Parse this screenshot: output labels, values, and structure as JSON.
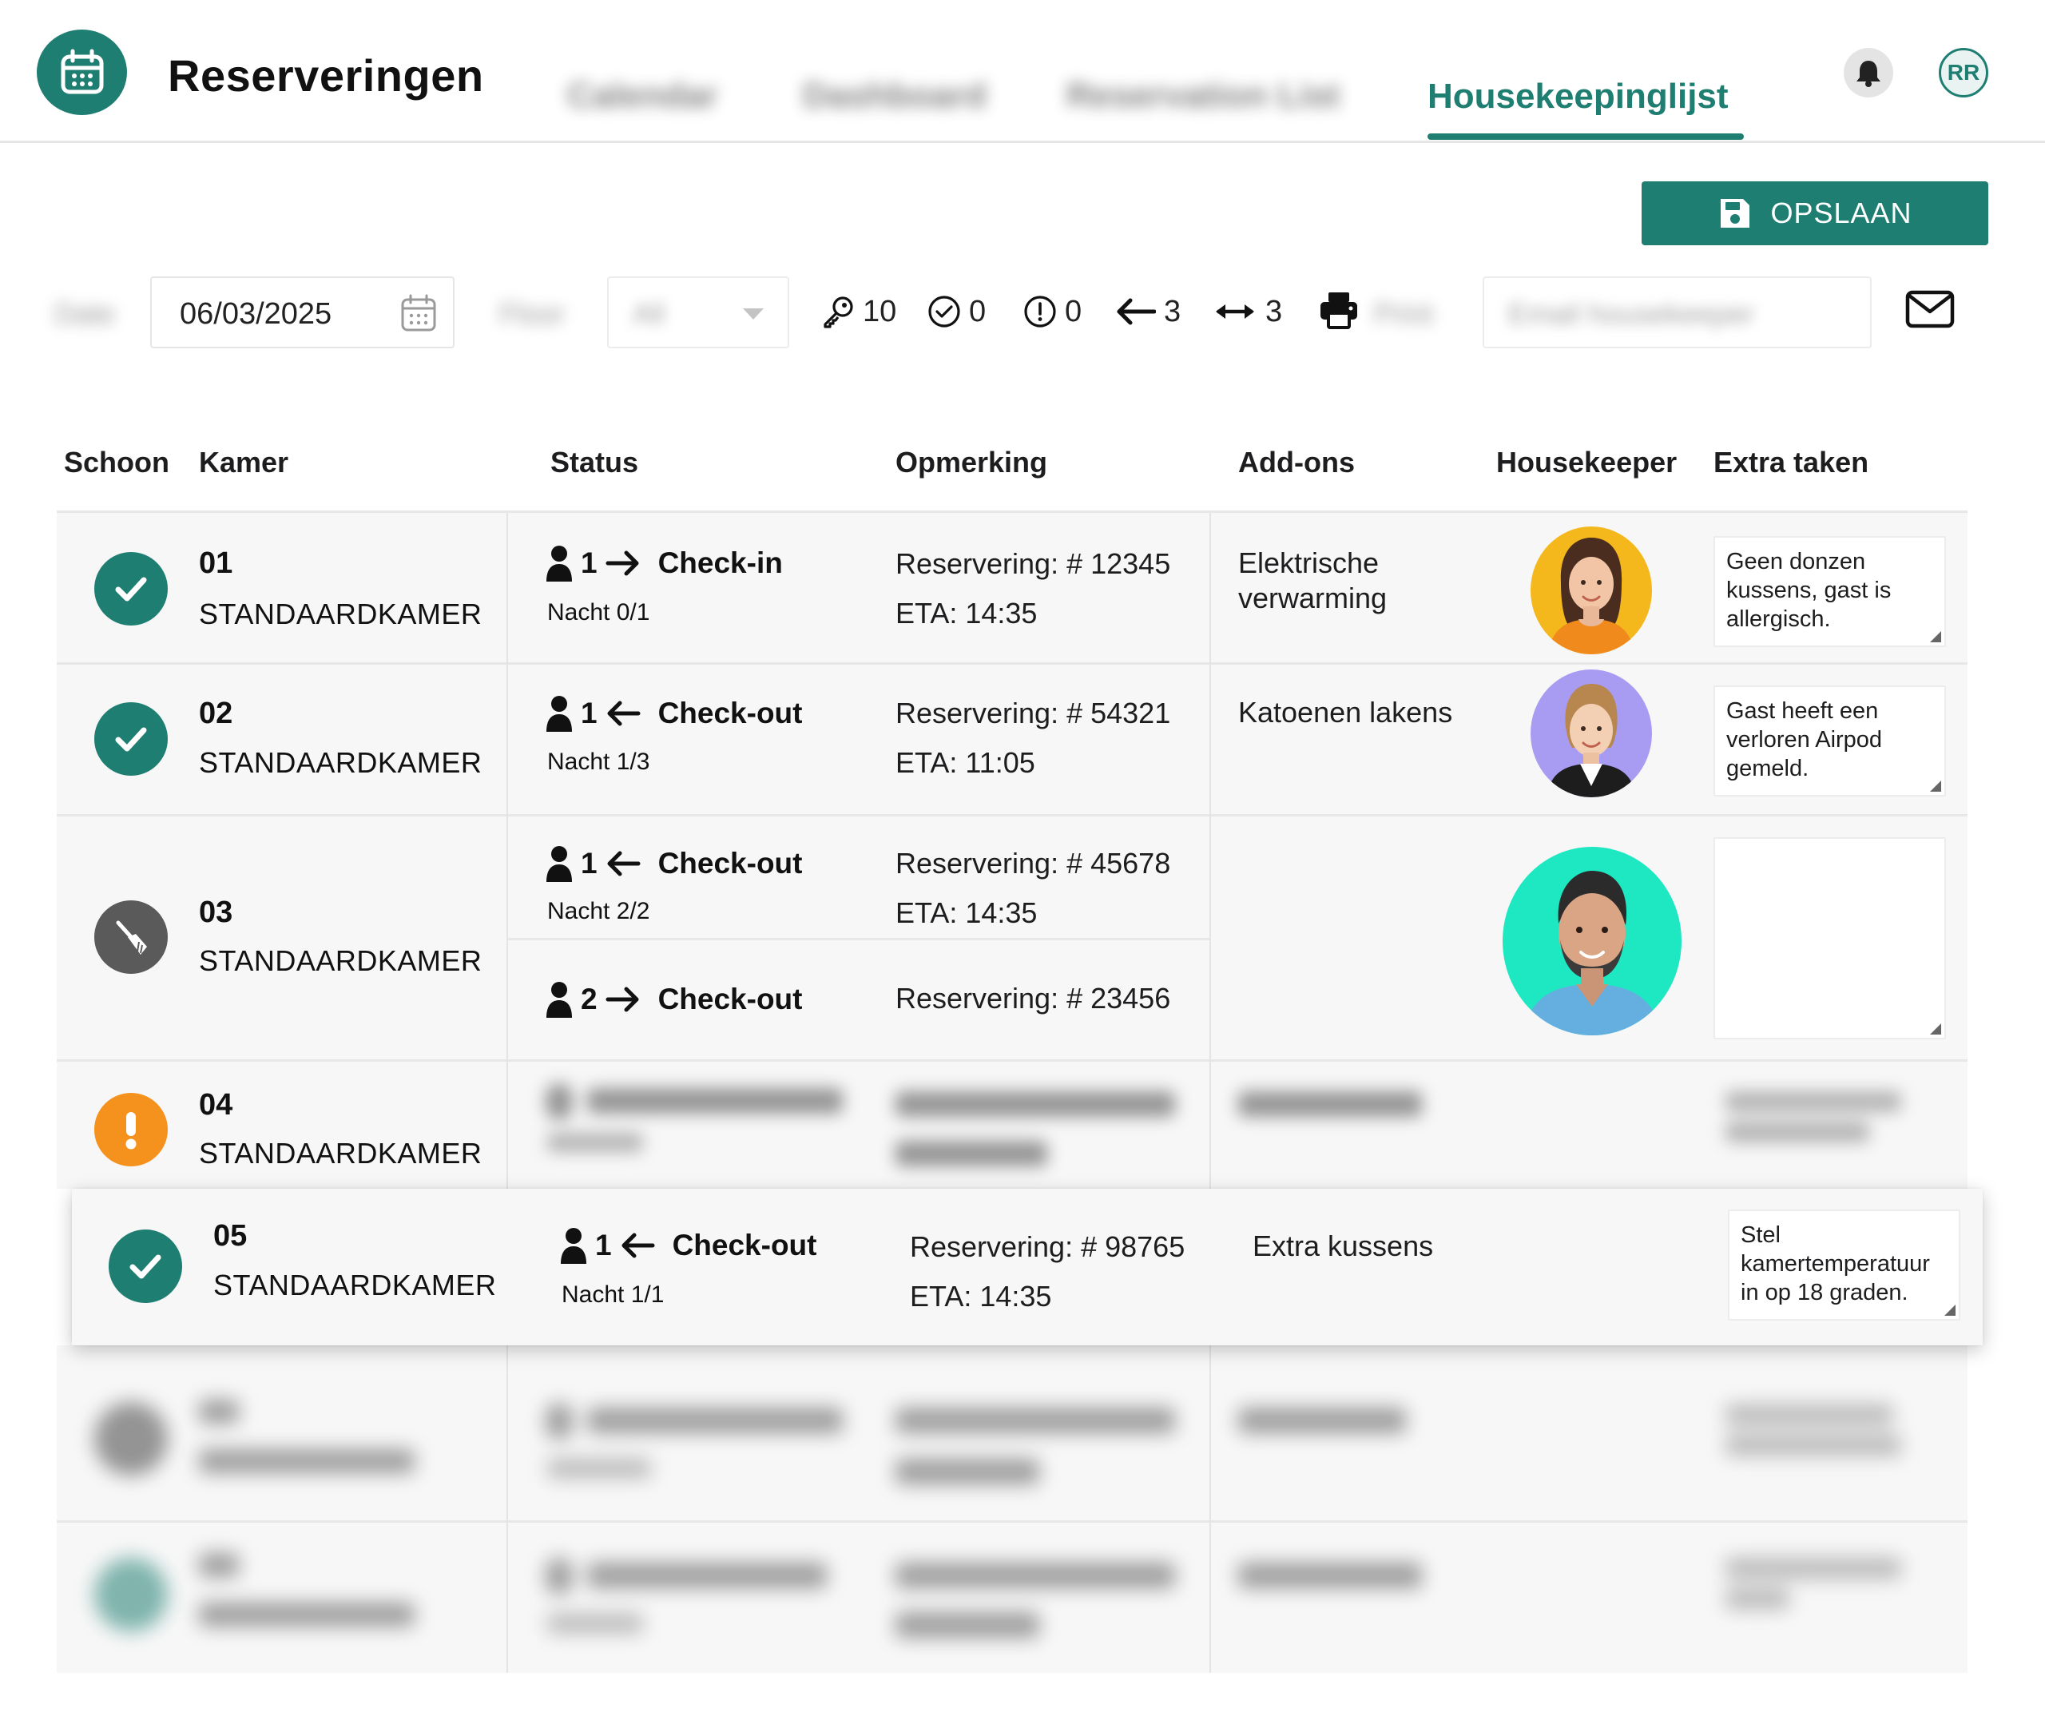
{
  "header": {
    "app_title": "Reserveringen",
    "tabs": [
      {
        "label": "Calendar",
        "active": false
      },
      {
        "label": "Dashboard",
        "active": false
      },
      {
        "label": "Reservation List",
        "active": false
      },
      {
        "label": "Housekeepinglijst",
        "active": true
      }
    ],
    "user_initials": "RR"
  },
  "toolbar": {
    "save_label": "OPSLAAN",
    "date_label": "Date",
    "date_value": "06/03/2025",
    "floor_label": "Floor",
    "floor_value": "All",
    "stats": {
      "keys": "10",
      "clean": "0",
      "alerts": "0",
      "checkouts": "3",
      "stayovers": "3"
    },
    "print_label": "Print",
    "email_placeholder": "Email housekeeper"
  },
  "table": {
    "headers": {
      "clean": "Schoon",
      "room": "Kamer",
      "status": "Status",
      "remark": "Opmerking",
      "addons": "Add-ons",
      "housekeeper": "Housekeeper",
      "extra": "Extra taken"
    },
    "rows": [
      {
        "room_number": "01",
        "room_type": "STANDAARDKAMER",
        "clean_state": "clean",
        "guests": "1",
        "direction": "in",
        "status": "Check-in",
        "night": "Nacht 0/1",
        "reservation": "Reservering: # 12345",
        "eta": "ETA: 14:35",
        "addons": "Elektrische verwarming",
        "extra_task": "Geen donzen kussens, gast is allergisch."
      },
      {
        "room_number": "02",
        "room_type": "STANDAARDKAMER",
        "clean_state": "clean",
        "guests": "1",
        "direction": "out",
        "status": "Check-out",
        "night": "Nacht 1/3",
        "reservation": "Reservering: # 54321",
        "eta": "ETA: 11:05",
        "addons": "Katoenen lakens",
        "extra_task": "Gast heeft een verloren Airpod gemeld."
      },
      {
        "room_number": "03",
        "room_type": "STANDAARDKAMER",
        "clean_state": "cleaning",
        "sub": [
          {
            "guests": "1",
            "direction": "out",
            "status": "Check-out",
            "night": "Nacht 2/2",
            "reservation": "Reservering: # 45678",
            "eta": "ETA: 14:35"
          },
          {
            "guests": "2",
            "direction": "in",
            "status": "Check-out",
            "reservation": "Reservering: # 23456"
          }
        ],
        "addons": "",
        "extra_task": ""
      },
      {
        "room_number": "04",
        "room_type": "STANDAARDKAMER",
        "clean_state": "attention"
      },
      {
        "room_number": "05",
        "room_type": "STANDAARDKAMER",
        "clean_state": "clean",
        "guests": "1",
        "direction": "out",
        "status": "Check-out",
        "night": "Nacht 1/1",
        "reservation": "Reservering: # 98765",
        "eta": "ETA: 14:35",
        "addons": "Extra kussens",
        "extra_task": "Stel kamertemperatuur in op 18 graden."
      }
    ]
  },
  "colors": {
    "accent": "#1f7e72",
    "clean": "#1f7e72",
    "cleaning": "#5a5a5a",
    "attention": "#f5921e",
    "row_bg": "#f7f7f7"
  },
  "icons": {
    "logo": "calendar-icon",
    "notifications": "bell-icon",
    "save": "floppy-disk-icon",
    "date": "calendar-icon",
    "keys": "key-icon",
    "clean": "check-circle-icon",
    "alerts": "exclamation-circle-icon",
    "checkouts": "arrow-left-icon",
    "stayovers": "arrows-left-right-icon",
    "print": "printer-icon",
    "email": "envelope-icon",
    "guest": "person-icon",
    "cleaning": "broom-icon"
  }
}
